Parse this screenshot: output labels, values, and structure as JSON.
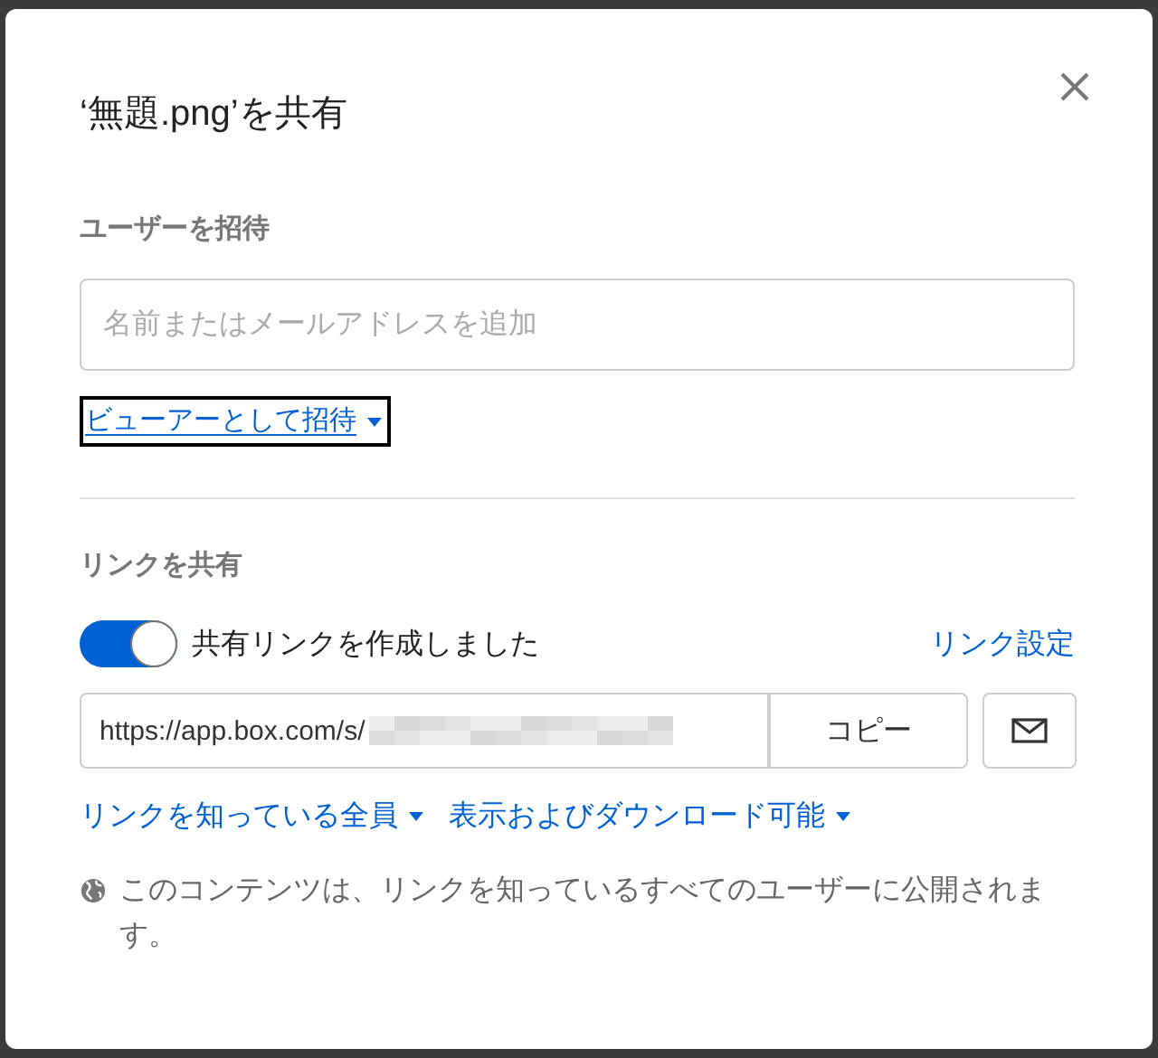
{
  "dialog": {
    "title": "‘無題.png’を共有"
  },
  "invite": {
    "heading": "ユーザーを招待",
    "placeholder": "名前またはメールアドレスを追加",
    "role_link": "ビューアーとして招待",
    "focused": true
  },
  "share": {
    "heading": "リンクを共有",
    "toggle": {
      "on": true,
      "label": "共有リンクを作成しました"
    },
    "settings_link": "リンク設定",
    "url": "https://app.box.com/s/",
    "copy_button": "コピー",
    "access": "リンクを知っている全員",
    "permission": "表示およびダウンロード可能",
    "note": "このコンテンツは、リンクを知っているすべてのユーザーに公開されます。"
  }
}
